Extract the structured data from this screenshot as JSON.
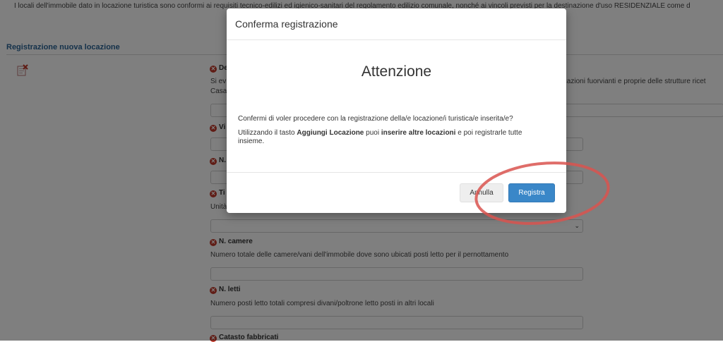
{
  "background": {
    "intro_text": "I locali dell'immobile dato in locazione turistica sono conformi ai requisiti tecnico-edilizi ed igienico-sanitari del regolamento edilizio comunale, nonché ai vincoli previsti per la destinazione d'uso RESIDENZIALE come d",
    "section_title": "Registrazione nuova locazione",
    "fields": [
      {
        "label": "N. camere",
        "description": "Numero totale delle camere/vani dell'immobile dove sono ubicati posti letto per il pernottamento"
      },
      {
        "label": "N. letti",
        "description": "Numero posti letto totali compresi divani/poltrone letto posti in altri locali"
      },
      {
        "label": "Catasto fabbricati"
      }
    ],
    "partial_label_1": "De",
    "partial_desc_1": "Si ev",
    "partial_desc_1_right": "dicazioni fuorvianti e proprie delle strutture ricet",
    "partial_desc_1b": "Casa",
    "partial_label_2": "Vi",
    "partial_label_3": "N.",
    "partial_label_4": "Ti",
    "partial_desc_4": "Unità"
  },
  "modal": {
    "title": "Conferma registrazione",
    "heading": "Attenzione",
    "confirm_text": "Confermi di voler procedere con la registrazione della/e locazione/i turistica/e inserita/e?",
    "hint_pre": "Utilizzando il tasto ",
    "hint_b1": "Aggiungi Locazione",
    "hint_mid": " puoi ",
    "hint_b2": "inserire altre locazioni",
    "hint_post": " e poi registrarle tutte insieme.",
    "cancel_label": "Annulla",
    "register_label": "Registra"
  },
  "colors": {
    "primary": "#3a87c8",
    "annotation": "#d9534f",
    "required": "#c0392b",
    "section_title": "#2a6496"
  }
}
